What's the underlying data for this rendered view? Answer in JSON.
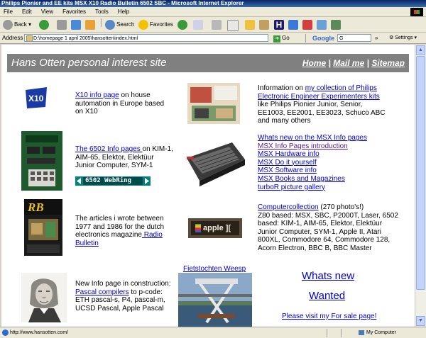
{
  "window": {
    "title": "Philips Pionier and EE kits MSX X10 Radio Bulletin 6502 SBC - Microsoft Internet Explorer"
  },
  "menu": [
    "File",
    "Edit",
    "View",
    "Favorites",
    "Tools",
    "Help"
  ],
  "toolbar": {
    "back": "Back",
    "search": "Search",
    "favorites": "Favorites"
  },
  "address": {
    "label": "Address",
    "value": "D:\\homepage 1 april 2005\\hansotten\\index.html",
    "go": "Go",
    "google": "Google",
    "google_value": "G",
    "settings": "Settings"
  },
  "banner": {
    "title": "Hans Otten personal interest site",
    "home": "Home",
    "mail": "Mail me",
    "sitemap": "Sitemap",
    "sep": "|"
  },
  "x10": {
    "link": "X10 info page",
    "text": " on house automation in Europe based on X10"
  },
  "ee": {
    "pre": "Information on ",
    "link": "my collection of Philips Electronic Engineer Experimenters kits",
    "text": " like Philips Pionier Junior, Senior, EE1003, EE2001, EE3023, Schuco ABC and many others"
  },
  "k6502": {
    "link": "The 6502 Info pages ",
    "text": "on KIM-1, AIM-65, Elektor, Elektüur Junior Computer, SYM-1",
    "webring": "6502 WebRing"
  },
  "msx": {
    "links": [
      "Whats new on the MSX Info pages",
      "MSX Info Pages introduction",
      "MSX Hardware info",
      "MSX Do it yourself",
      "MSX Software info",
      "MSX Books and Magazines",
      "turboR picture gallery"
    ]
  },
  "rb": {
    "text": "The articles i wrote between 1977 and 1986 for the dutch electronics magazine",
    "link": " Radio Bulletin",
    "logo": "RB"
  },
  "computers": {
    "link": "Computercollection",
    "count": " (270 photo's!)",
    "text": "Z80 based: MSX, SBC, P2000T, Laser, 6502 based: KIM-1, AIM-65, Elektor, Elektüur Junior Computer, SYM-1, Apple II, Atari 800XL, Commodore 64, Commodore 128, Acorn Electron, BBC B, BBC Master",
    "apple_label": "apple ][ "
  },
  "pascal": {
    "pre": "New Info page in construction:",
    "link": "Pascal compilers",
    "text": " to p-code: ETH pascal-s, P4, pascal-m, UCSD Pascal, Apple Pascal"
  },
  "fiets": {
    "link": "Fietstochten Weesp"
  },
  "right_links": {
    "whats_new": "Whats new",
    "wanted": "Wanted",
    "forsale": "Please visit my For sale page!"
  },
  "status": {
    "text": "http://www.hansotten.com/",
    "zone": "My Computer"
  }
}
